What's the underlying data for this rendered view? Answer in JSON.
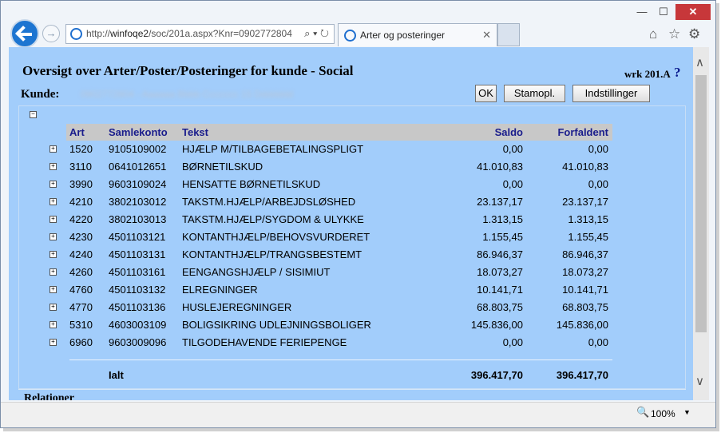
{
  "browser": {
    "url_prefix": "http://",
    "url_host": "winfoqe2",
    "url_rest": "/soc/201a.aspx?Knr=0902772804",
    "url_controls": "⌕ ▾ ↻",
    "tab_title": "Arter og posteringer",
    "min_glyph": "—",
    "max_glyph": "☐",
    "close_glyph": "✕",
    "fwd_glyph": "→",
    "tab_close_glyph": "✕",
    "home_glyph": "⌂",
    "star_glyph": "☆",
    "gear_glyph": "⚙",
    "zoom": "100%",
    "zoom_glyph": "🔍",
    "zoom_dd_glyph": "▼",
    "scroll_up": "∧",
    "scroll_dn": "∨"
  },
  "page": {
    "title": "Oversigt over Arter/Poster/Posteringer for kunde - Social",
    "wrk": "wrk 201.A",
    "help": "?",
    "kunde_label": "Kunde:",
    "kunde_value": "0902772804 - Aaaaaa Bbbb Ccccccc 15 Ddddddd",
    "buttons": {
      "ok": "OK",
      "stamopl": "Stamopl.",
      "indstillinger": "Indstillinger"
    },
    "collapse_glyph": "−",
    "expand_glyph": "+",
    "relationer": "Relationer"
  },
  "table": {
    "headers": {
      "art": "Art",
      "samlekonto": "Samlekonto",
      "tekst": "Tekst",
      "saldo": "Saldo",
      "forfaldent": "Forfaldent"
    },
    "rows": [
      {
        "art": "1520",
        "samlekonto": "9105109002",
        "tekst": "HJÆLP M/TILBAGEBETALINGSPLIGT",
        "saldo": "0,00",
        "forfaldent": "0,00"
      },
      {
        "art": "3110",
        "samlekonto": "0641012651",
        "tekst": "BØRNETILSKUD",
        "saldo": "41.010,83",
        "forfaldent": "41.010,83"
      },
      {
        "art": "3990",
        "samlekonto": "9603109024",
        "tekst": "HENSATTE BØRNETILSKUD",
        "saldo": "0,00",
        "forfaldent": "0,00"
      },
      {
        "art": "4210",
        "samlekonto": "3802103012",
        "tekst": "TAKSTM.HJÆLP/ARBEJDSLØSHED",
        "saldo": "23.137,17",
        "forfaldent": "23.137,17"
      },
      {
        "art": "4220",
        "samlekonto": "3802103013",
        "tekst": "TAKSTM.HJÆLP/SYGDOM & ULYKKE",
        "saldo": "1.313,15",
        "forfaldent": "1.313,15"
      },
      {
        "art": "4230",
        "samlekonto": "4501103121",
        "tekst": "KONTANTHJÆLP/BEHOVSVURDERET",
        "saldo": "1.155,45",
        "forfaldent": "1.155,45"
      },
      {
        "art": "4240",
        "samlekonto": "4501103131",
        "tekst": "KONTANTHJÆLP/TRANGSBESTEMT",
        "saldo": "86.946,37",
        "forfaldent": "86.946,37"
      },
      {
        "art": "4260",
        "samlekonto": "4501103161",
        "tekst": "EENGANGSHJÆLP / SISIMIUT",
        "saldo": "18.073,27",
        "forfaldent": "18.073,27"
      },
      {
        "art": "4760",
        "samlekonto": "4501103132",
        "tekst": "ELREGNINGER",
        "saldo": "10.141,71",
        "forfaldent": "10.141,71"
      },
      {
        "art": "4770",
        "samlekonto": "4501103136",
        "tekst": "HUSLEJEREGNINGER",
        "saldo": "68.803,75",
        "forfaldent": "68.803,75"
      },
      {
        "art": "5310",
        "samlekonto": "4603003109",
        "tekst": "BOLIGSIKRING UDLEJNINGSBOLIGER",
        "saldo": "145.836,00",
        "forfaldent": "145.836,00"
      },
      {
        "art": "6960",
        "samlekonto": "9603009096",
        "tekst": "TILGODEHAVENDE FERIEPENGE",
        "saldo": "0,00",
        "forfaldent": "0,00"
      }
    ],
    "total": {
      "label": "Ialt",
      "saldo": "396.417,70",
      "forfaldent": "396.417,70"
    }
  }
}
